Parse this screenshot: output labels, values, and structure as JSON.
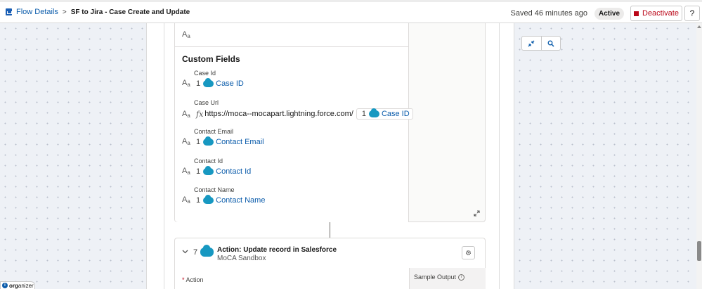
{
  "header": {
    "breadcrumb_link": "Flow Details",
    "breadcrumb_sep": ">",
    "flow_title": "SF to Jira - Case Create and Update",
    "saved_status": "Saved 46 minutes ago",
    "status_badge": "Active",
    "deactivate_label": "Deactivate",
    "help_label": "?"
  },
  "card": {
    "section_title": "Custom Fields",
    "top_type_icon": "text-type-icon",
    "fields": [
      {
        "label": "Case Id",
        "step": "1",
        "token": "Case ID"
      },
      {
        "label": "Case Url",
        "url": "https://moca--mocapart.lightning.force.com/",
        "step": "1",
        "token": "Case ID"
      },
      {
        "label": "Contact Email",
        "step": "1",
        "token": "Contact Email"
      },
      {
        "label": "Contact Id",
        "step": "1",
        "token": "Contact Id"
      },
      {
        "label": "Contact Name",
        "step": "1",
        "token": "Contact Name"
      }
    ]
  },
  "step": {
    "index": "7",
    "title": "Action: Update record in Salesforce",
    "subtitle": "MoCA Sandbox",
    "sample_output": "Sample Output",
    "action_label": "Action",
    "required_mark": "*"
  },
  "organizer": {
    "prefix": "org",
    "suffix": "anizer"
  },
  "icons": {
    "zoom_fit": "collapse-arrows-icon",
    "zoom_search": "search-icon",
    "expand": "expand-arrows-icon",
    "gear": "gear-icon",
    "chevron": "chevron-down-icon",
    "salesforce": "salesforce-cloud-icon"
  },
  "colors": {
    "link": "#0b5cab",
    "danger": "#ba0517",
    "salesforce_blue": "#1798c1",
    "canvas": "#eef1f6"
  }
}
